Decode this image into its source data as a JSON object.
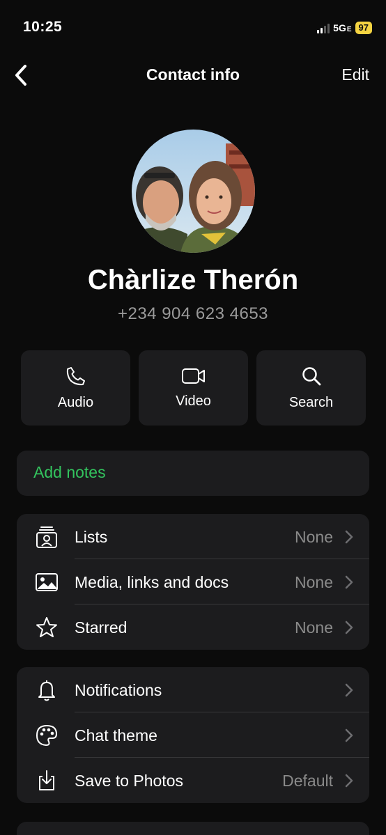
{
  "status": {
    "time": "10:25",
    "network": "5G",
    "network_suffix": "E",
    "battery": "97"
  },
  "nav": {
    "title": "Contact info",
    "edit_label": "Edit"
  },
  "contact": {
    "name": "Chàrlize Therón",
    "phone": "+234 904 623 4653"
  },
  "actions": [
    {
      "label": "Audio",
      "icon": "phone-icon"
    },
    {
      "label": "Video",
      "icon": "video-icon"
    },
    {
      "label": "Search",
      "icon": "search-icon"
    }
  ],
  "notes": {
    "label": "Add notes"
  },
  "group1": [
    {
      "label": "Lists",
      "value": "None",
      "icon": "lists-icon"
    },
    {
      "label": "Media, links and docs",
      "value": "None",
      "icon": "image-icon"
    },
    {
      "label": "Starred",
      "value": "None",
      "icon": "star-icon"
    }
  ],
  "group2": [
    {
      "label": "Notifications",
      "value": "",
      "icon": "bell-icon"
    },
    {
      "label": "Chat theme",
      "value": "",
      "icon": "palette-icon"
    },
    {
      "label": "Save to Photos",
      "value": "Default",
      "icon": "save-download-icon"
    }
  ],
  "colors": {
    "accent_green": "#33c45e",
    "card_bg": "#1c1c1e",
    "page_bg": "#0b0b0b",
    "battery": "#f5d442"
  }
}
